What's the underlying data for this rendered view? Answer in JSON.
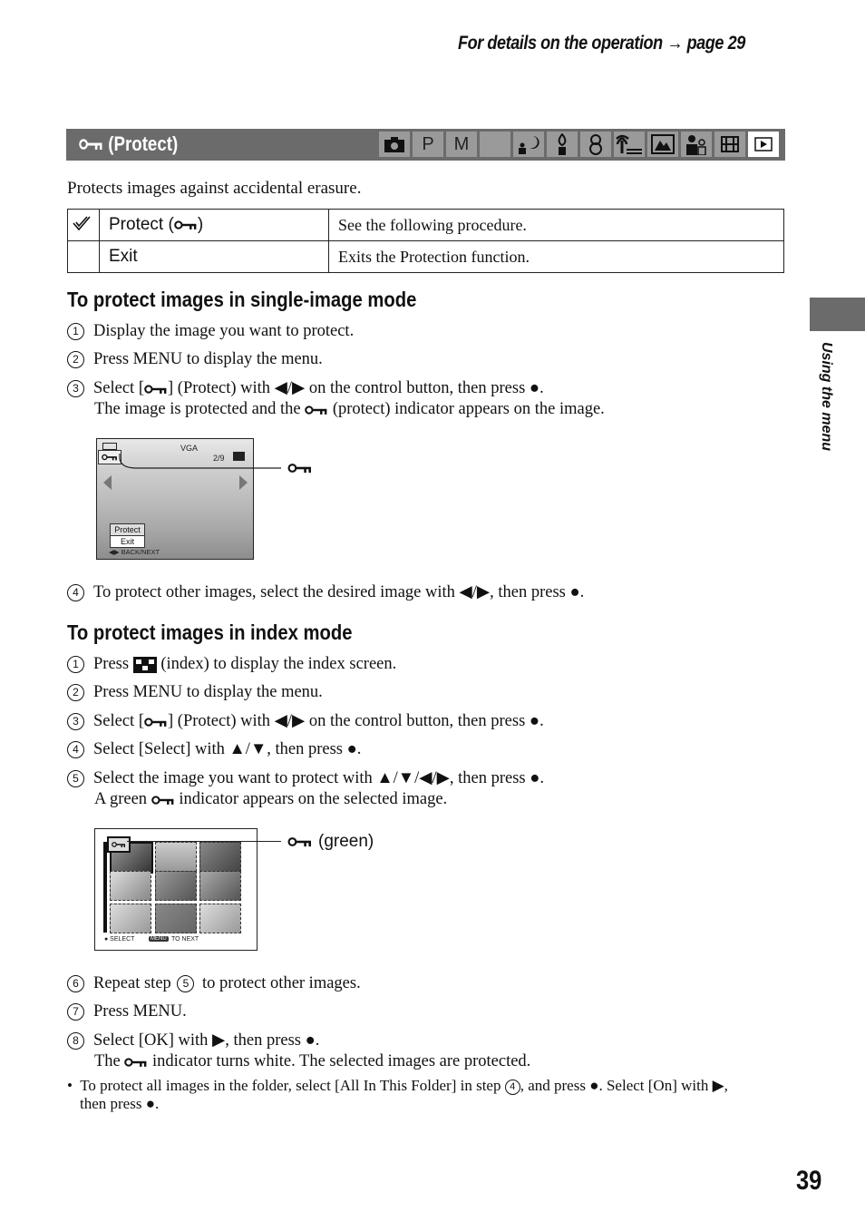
{
  "header": {
    "reference": "For details on the operation → page 29"
  },
  "section": {
    "title": "(Protect)",
    "title_icon": "key-icon",
    "modes": [
      {
        "icon": "camera-icon",
        "label": ""
      },
      {
        "icon": "program-mode",
        "label": "P"
      },
      {
        "icon": "manual-mode",
        "label": "M"
      },
      {
        "icon": "twilight-icon",
        "label": "☾"
      },
      {
        "icon": "twilight-portrait-icon",
        "label": "☾"
      },
      {
        "icon": "candle-icon",
        "label": "△"
      },
      {
        "icon": "snow-icon",
        "label": "☃"
      },
      {
        "icon": "beach-icon",
        "label": "⸙"
      },
      {
        "icon": "landscape-icon",
        "label": "▲"
      },
      {
        "icon": "portrait-icon",
        "label": "♟"
      },
      {
        "icon": "movie-icon",
        "label": "▒"
      },
      {
        "icon": "playback-icon",
        "label": "▶"
      }
    ],
    "active_mode_index": 11,
    "intro": "Protects images against accidental erasure."
  },
  "options_table": [
    {
      "selected": true,
      "name": "Protect (",
      "name_suffix": ")",
      "has_key": true,
      "description": "See the following procedure."
    },
    {
      "selected": false,
      "name": "Exit",
      "name_suffix": "",
      "has_key": false,
      "description": "Exits the Protection function."
    }
  ],
  "single_mode": {
    "heading": "To protect images in single-image mode",
    "steps": [
      {
        "num": "1",
        "text": "Display the image you want to protect."
      },
      {
        "num": "2",
        "text": "Press MENU to display the menu."
      },
      {
        "num": "3",
        "text_a": "Select [",
        "text_b": "] (Protect) with ◀/▶ on the control button, then press ●.",
        "cont_a": "The image is protected and the ",
        "cont_b": " (protect) indicator appears on the image."
      },
      {
        "num": "4",
        "text": "To protect other images, select the desired image with ◀/▶, then press ●."
      }
    ],
    "screen": {
      "resolution": "VGA",
      "counter": "2/9",
      "menu_items": [
        "Protect",
        "Exit"
      ],
      "footer": "◀▶ BACK/NEXT"
    },
    "callout_label": ""
  },
  "index_mode": {
    "heading": "To protect images in index mode",
    "steps": [
      {
        "num": "1",
        "text_a": "Press ",
        "text_b": " (index) to display the index screen."
      },
      {
        "num": "2",
        "text": "Press MENU to display the menu."
      },
      {
        "num": "3",
        "text_a": "Select [",
        "text_b": "] (Protect) with ◀/▶ on the control button, then press ●."
      },
      {
        "num": "4",
        "text": "Select [Select] with ▲/▼, then press ●."
      },
      {
        "num": "5",
        "text": "Select the image you want to protect with ▲/▼/◀/▶, then press ●.",
        "cont_a": "A green ",
        "cont_b": " indicator appears on the selected image."
      },
      {
        "num": "6",
        "text_a": "Repeat step ",
        "step_ref": "5",
        "text_b": " to protect other images."
      },
      {
        "num": "7",
        "text": "Press MENU."
      },
      {
        "num": "8",
        "text": "Select [OK] with ▶, then press ●.",
        "cont_a": "The ",
        "cont_b": " indicator turns white. The selected images are protected."
      }
    ],
    "screen": {
      "footer_left": "● SELECT",
      "footer_menu": "MENU",
      "footer_right": "TO NEXT"
    },
    "callout_label": "(green)"
  },
  "note": {
    "line1_a": "To protect all images in the folder, select [All In This Folder] in step ",
    "step_ref": "4",
    "line1_b": ", and press ●. Select [On] with ▶,",
    "line2": "then press ●."
  },
  "side_tab": {
    "label": "Using the menu"
  },
  "page_number": "39"
}
